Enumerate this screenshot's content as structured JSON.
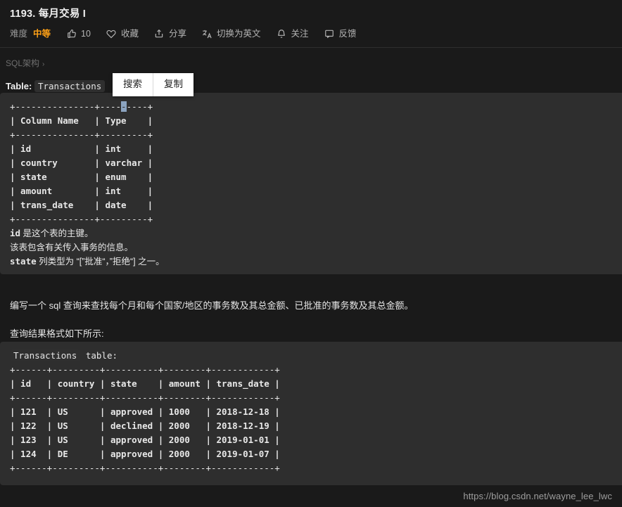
{
  "header": {
    "title": "1193. 每月交易 I",
    "difficulty_label": "难度",
    "difficulty_value": "中等",
    "actions": [
      {
        "icon": "thumbs-up-icon",
        "label": "10"
      },
      {
        "icon": "heart-icon",
        "label": "收藏"
      },
      {
        "icon": "share-icon",
        "label": "分享"
      },
      {
        "icon": "translate-icon",
        "label": "切换为英文"
      },
      {
        "icon": "bell-icon",
        "label": "关注"
      },
      {
        "icon": "feedback-icon",
        "label": "反馈"
      }
    ]
  },
  "breadcrumb": {
    "label": "SQL架构",
    "chevron": "›"
  },
  "table_intro": {
    "prefix": "Table:",
    "name": "Transactions"
  },
  "context_menu": {
    "search": "搜索",
    "copy": "复制"
  },
  "schema_block": {
    "border_top": "+---------------+---------+",
    "header_row": "| Column Name   | Type    |",
    "rows": [
      "| id            | int     |",
      "| country       | varchar |",
      "| state         | enum    |",
      "| amount        | int     |",
      "| trans_date    | date    |"
    ],
    "border_bottom": "+---------------+---------+",
    "notes": [
      "id 是这个表的主键。",
      "该表包含有关传入事务的信息。",
      "state 列类型为 “[”批准“，”拒绝“] 之一。"
    ],
    "selected_char": "-"
  },
  "question": {
    "paragraph_1": "编写一个 sql 查询来查找每个月和每个国家/地区的事务数及其总金额、已批准的事务数及其总金额。",
    "paragraph_2": "查询结果格式如下所示:"
  },
  "example_block": {
    "caption_code": "Transactions",
    "caption_text": " table:",
    "border": "+------+---------+----------+--------+------------+",
    "header_row": "| id   | country | state    | amount | trans_date |",
    "rows": [
      "| 121  | US      | approved | 1000   | 2018-12-18 |",
      "| 122  | US      | declined | 2000   | 2018-12-19 |",
      "| 123  | US      | approved | 2000   | 2019-01-01 |",
      "| 124  | DE      | approved | 2000   | 2019-01-07 |"
    ]
  },
  "watermark": "https://blog.csdn.net/wayne_lee_lwc",
  "colors": {
    "page_bg": "#1a1a1a",
    "code_bg": "#2e2e2e",
    "accent_orange": "#ffa116",
    "selection": "#8ba3bf"
  },
  "table_data": {
    "type": "table",
    "schema": {
      "columns": [
        "Column Name",
        "Type"
      ],
      "rows": [
        [
          "id",
          "int"
        ],
        [
          "country",
          "varchar"
        ],
        [
          "state",
          "enum"
        ],
        [
          "amount",
          "int"
        ],
        [
          "trans_date",
          "date"
        ]
      ]
    },
    "example": {
      "columns": [
        "id",
        "country",
        "state",
        "amount",
        "trans_date"
      ],
      "rows": [
        [
          "121",
          "US",
          "approved",
          "1000",
          "2018-12-18"
        ],
        [
          "122",
          "US",
          "declined",
          "2000",
          "2018-12-19"
        ],
        [
          "123",
          "US",
          "approved",
          "2000",
          "2019-01-01"
        ],
        [
          "124",
          "DE",
          "approved",
          "2000",
          "2019-01-07"
        ]
      ]
    }
  }
}
